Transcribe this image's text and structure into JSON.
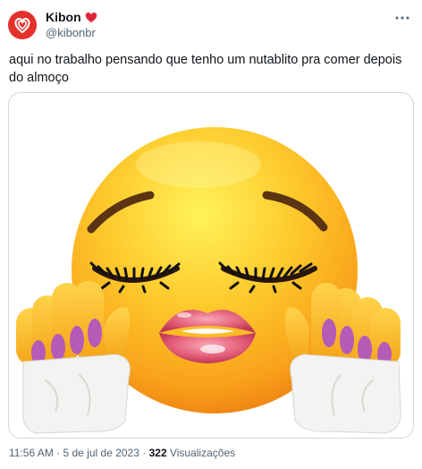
{
  "author": {
    "display_name": "Kibon",
    "handle": "@kibonbr",
    "avatar_icon": "kibon-heart-logo",
    "badge_icon": "red-heart-icon"
  },
  "post": {
    "text": "aqui no trabalho pensando que tenho um nutablito pra comer depois do almoço",
    "media_icon": "kissing-emoji-with-lips-lashes-and-nails"
  },
  "meta": {
    "time": "11:56 AM",
    "separator": "·",
    "date": "5 de jul de 2023",
    "views_count": "322",
    "views_label": "Visualizações"
  },
  "colors": {
    "brand": "#e4312b",
    "text": "#0f1419",
    "muted": "#536471"
  }
}
